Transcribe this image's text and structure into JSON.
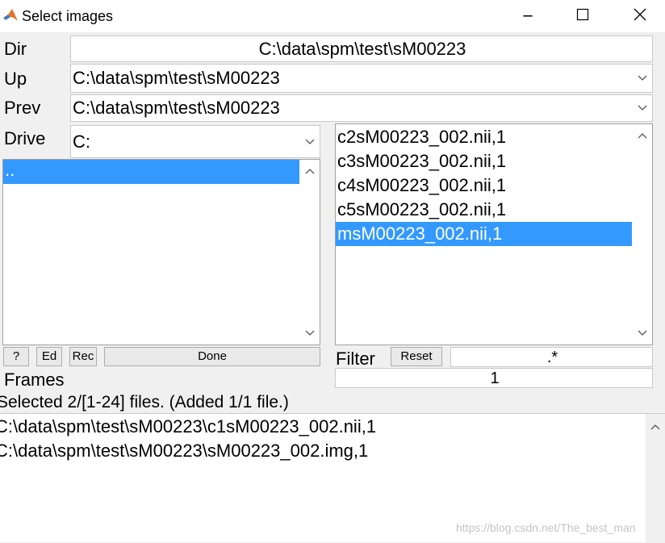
{
  "window": {
    "title": "Select images",
    "minimize_glyph": "─",
    "maximize_glyph": "☐",
    "close_glyph": "✕"
  },
  "dir": {
    "label": "Dir",
    "value": "C:\\data\\spm\\test\\sM00223"
  },
  "up": {
    "label": "Up",
    "value": "C:\\data\\spm\\test\\sM00223"
  },
  "prev": {
    "label": "Prev",
    "value": "C:\\data\\spm\\test\\sM00223"
  },
  "drive": {
    "label": "Drive",
    "value": "C:"
  },
  "dir_list": {
    "items": [
      ".."
    ]
  },
  "file_list": {
    "items": [
      "c2sM00223_002.nii,1",
      "c3sM00223_002.nii,1",
      "c4sM00223_002.nii,1",
      "c5sM00223_002.nii,1",
      "msM00223_002.nii,1"
    ],
    "selected_index": 4
  },
  "buttons": {
    "help": "?",
    "edit": "Ed",
    "rec": "Rec",
    "done": "Done",
    "reset": "Reset"
  },
  "filter": {
    "label": "Filter",
    "value": ".*"
  },
  "frames": {
    "label": "Frames",
    "value": "1"
  },
  "status": "Selected 2/[1-24] files. (Added 1/1 file.)",
  "selected_files": [
    "C:\\data\\spm\\test\\sM00223\\c1sM00223_002.nii,1",
    "C:\\data\\spm\\test\\sM00223\\sM00223_002.img,1"
  ],
  "watermark": "https://blog.csdn.net/The_best_man",
  "icons": {
    "app": "matlab-logo-icon",
    "chevron": "chevron-down-icon"
  },
  "colors": {
    "selection": "#3399ff",
    "window_bg": "#f0f0f0"
  }
}
